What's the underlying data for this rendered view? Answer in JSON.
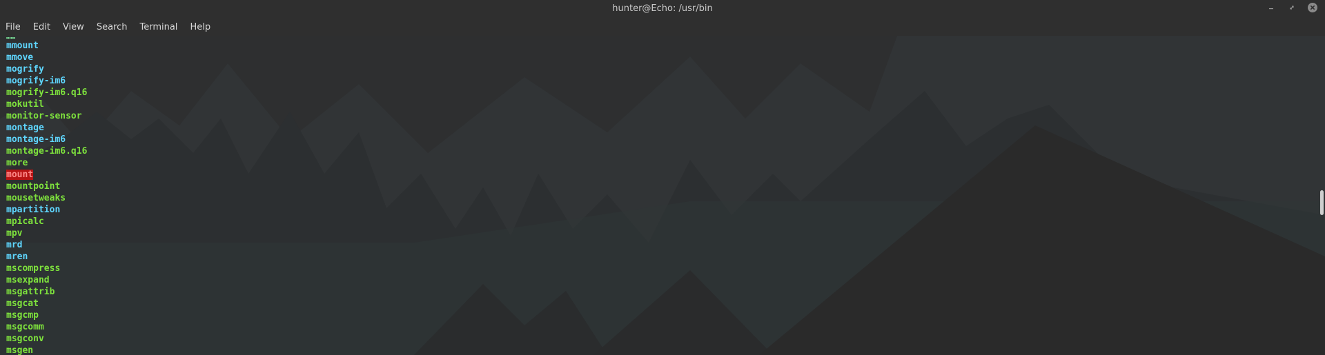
{
  "window": {
    "title": "hunter@Echo: /usr/bin"
  },
  "menu": {
    "items": [
      "File",
      "Edit",
      "View",
      "Search",
      "Terminal",
      "Help"
    ]
  },
  "terminal": {
    "partial_top_line": "……",
    "lines": [
      {
        "text": "mmount",
        "color": "cyan"
      },
      {
        "text": "mmove",
        "color": "cyan"
      },
      {
        "text": "mogrify",
        "color": "cyan"
      },
      {
        "text": "mogrify-im6",
        "color": "cyan"
      },
      {
        "text": "mogrify-im6.q16",
        "color": "green"
      },
      {
        "text": "mokutil",
        "color": "green"
      },
      {
        "text": "monitor-sensor",
        "color": "green"
      },
      {
        "text": "montage",
        "color": "cyan"
      },
      {
        "text": "montage-im6",
        "color": "cyan"
      },
      {
        "text": "montage-im6.q16",
        "color": "green"
      },
      {
        "text": "more",
        "color": "green"
      },
      {
        "text": "mount",
        "color": "highlight"
      },
      {
        "text": "mountpoint",
        "color": "green"
      },
      {
        "text": "mousetweaks",
        "color": "green"
      },
      {
        "text": "mpartition",
        "color": "cyan"
      },
      {
        "text": "mpicalc",
        "color": "green"
      },
      {
        "text": "mpv",
        "color": "green"
      },
      {
        "text": "mrd",
        "color": "cyan"
      },
      {
        "text": "mren",
        "color": "cyan"
      },
      {
        "text": "mscompress",
        "color": "green"
      },
      {
        "text": "msexpand",
        "color": "green"
      },
      {
        "text": "msgattrib",
        "color": "green"
      },
      {
        "text": "msgcat",
        "color": "green"
      },
      {
        "text": "msgcmp",
        "color": "green"
      },
      {
        "text": "msgcomm",
        "color": "green"
      },
      {
        "text": "msgconv",
        "color": "green"
      },
      {
        "text": "msgen",
        "color": "green"
      }
    ]
  },
  "colors": {
    "cyan": "#5fd7ff",
    "green": "#7ee23d",
    "highlight_bg": "#b81414",
    "highlight_fg": "#ff8a8a"
  },
  "icons": {
    "minimize": "minimize-icon",
    "maximize": "maximize-icon",
    "close": "close-icon"
  }
}
